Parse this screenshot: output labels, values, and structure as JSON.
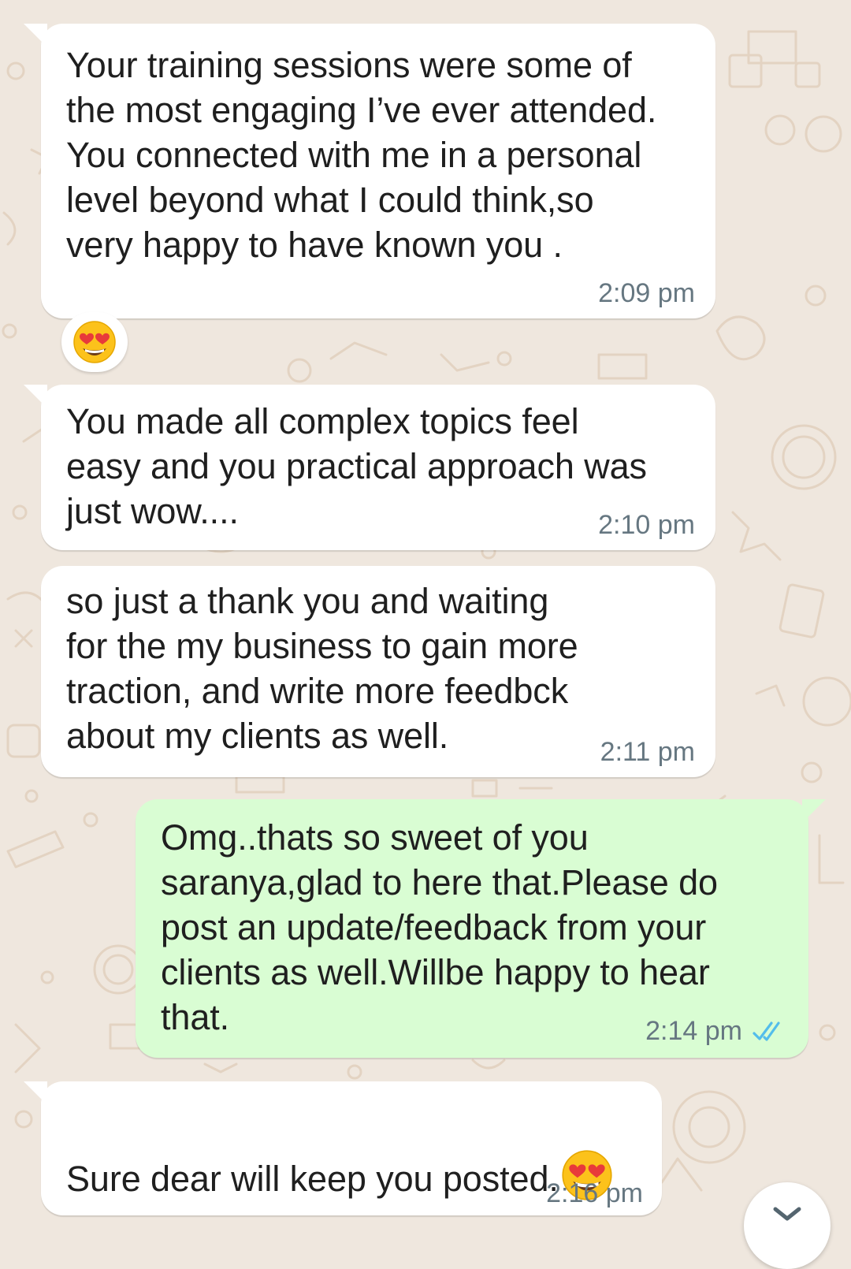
{
  "messages": [
    {
      "direction": "incoming",
      "text": "Your training sessions were some of\nthe most engaging I’ve ever attended.\nYou connected with me in a personal\nlevel beyond what I could think,so\nvery happy to have known you .",
      "time": "2:09 pm",
      "reaction": "smiling-face-with-heart-eyes"
    },
    {
      "direction": "incoming",
      "text": "You made all complex topics feel\neasy and you practical approach was\njust wow....",
      "time": "2:10 pm"
    },
    {
      "direction": "incoming",
      "text": "so just a thank you and waiting\nfor the my business to gain more\ntraction, and write more feedbck\nabout my clients as well.",
      "time": "2:11 pm"
    },
    {
      "direction": "outgoing",
      "text": "Omg..thats so sweet of you\nsaranya,glad to here that.Please do\npost an update/feedback from your\nclients as well.Willbe happy to hear\nthat.",
      "time": "2:14 pm",
      "status": "read",
      "status_color": "#53bdeb"
    },
    {
      "direction": "incoming",
      "text": "Sure dear will keep you posted.",
      "emoji": "smiling-face-with-heart-eyes",
      "time": "2:16 pm"
    }
  ],
  "colors": {
    "wallpaper": "#efe7de",
    "incoming_bubble": "#ffffff",
    "outgoing_bubble": "#d9fdd3",
    "timestamp": "#667781"
  },
  "icons": {
    "scroll_down": "chevron-down-icon"
  }
}
